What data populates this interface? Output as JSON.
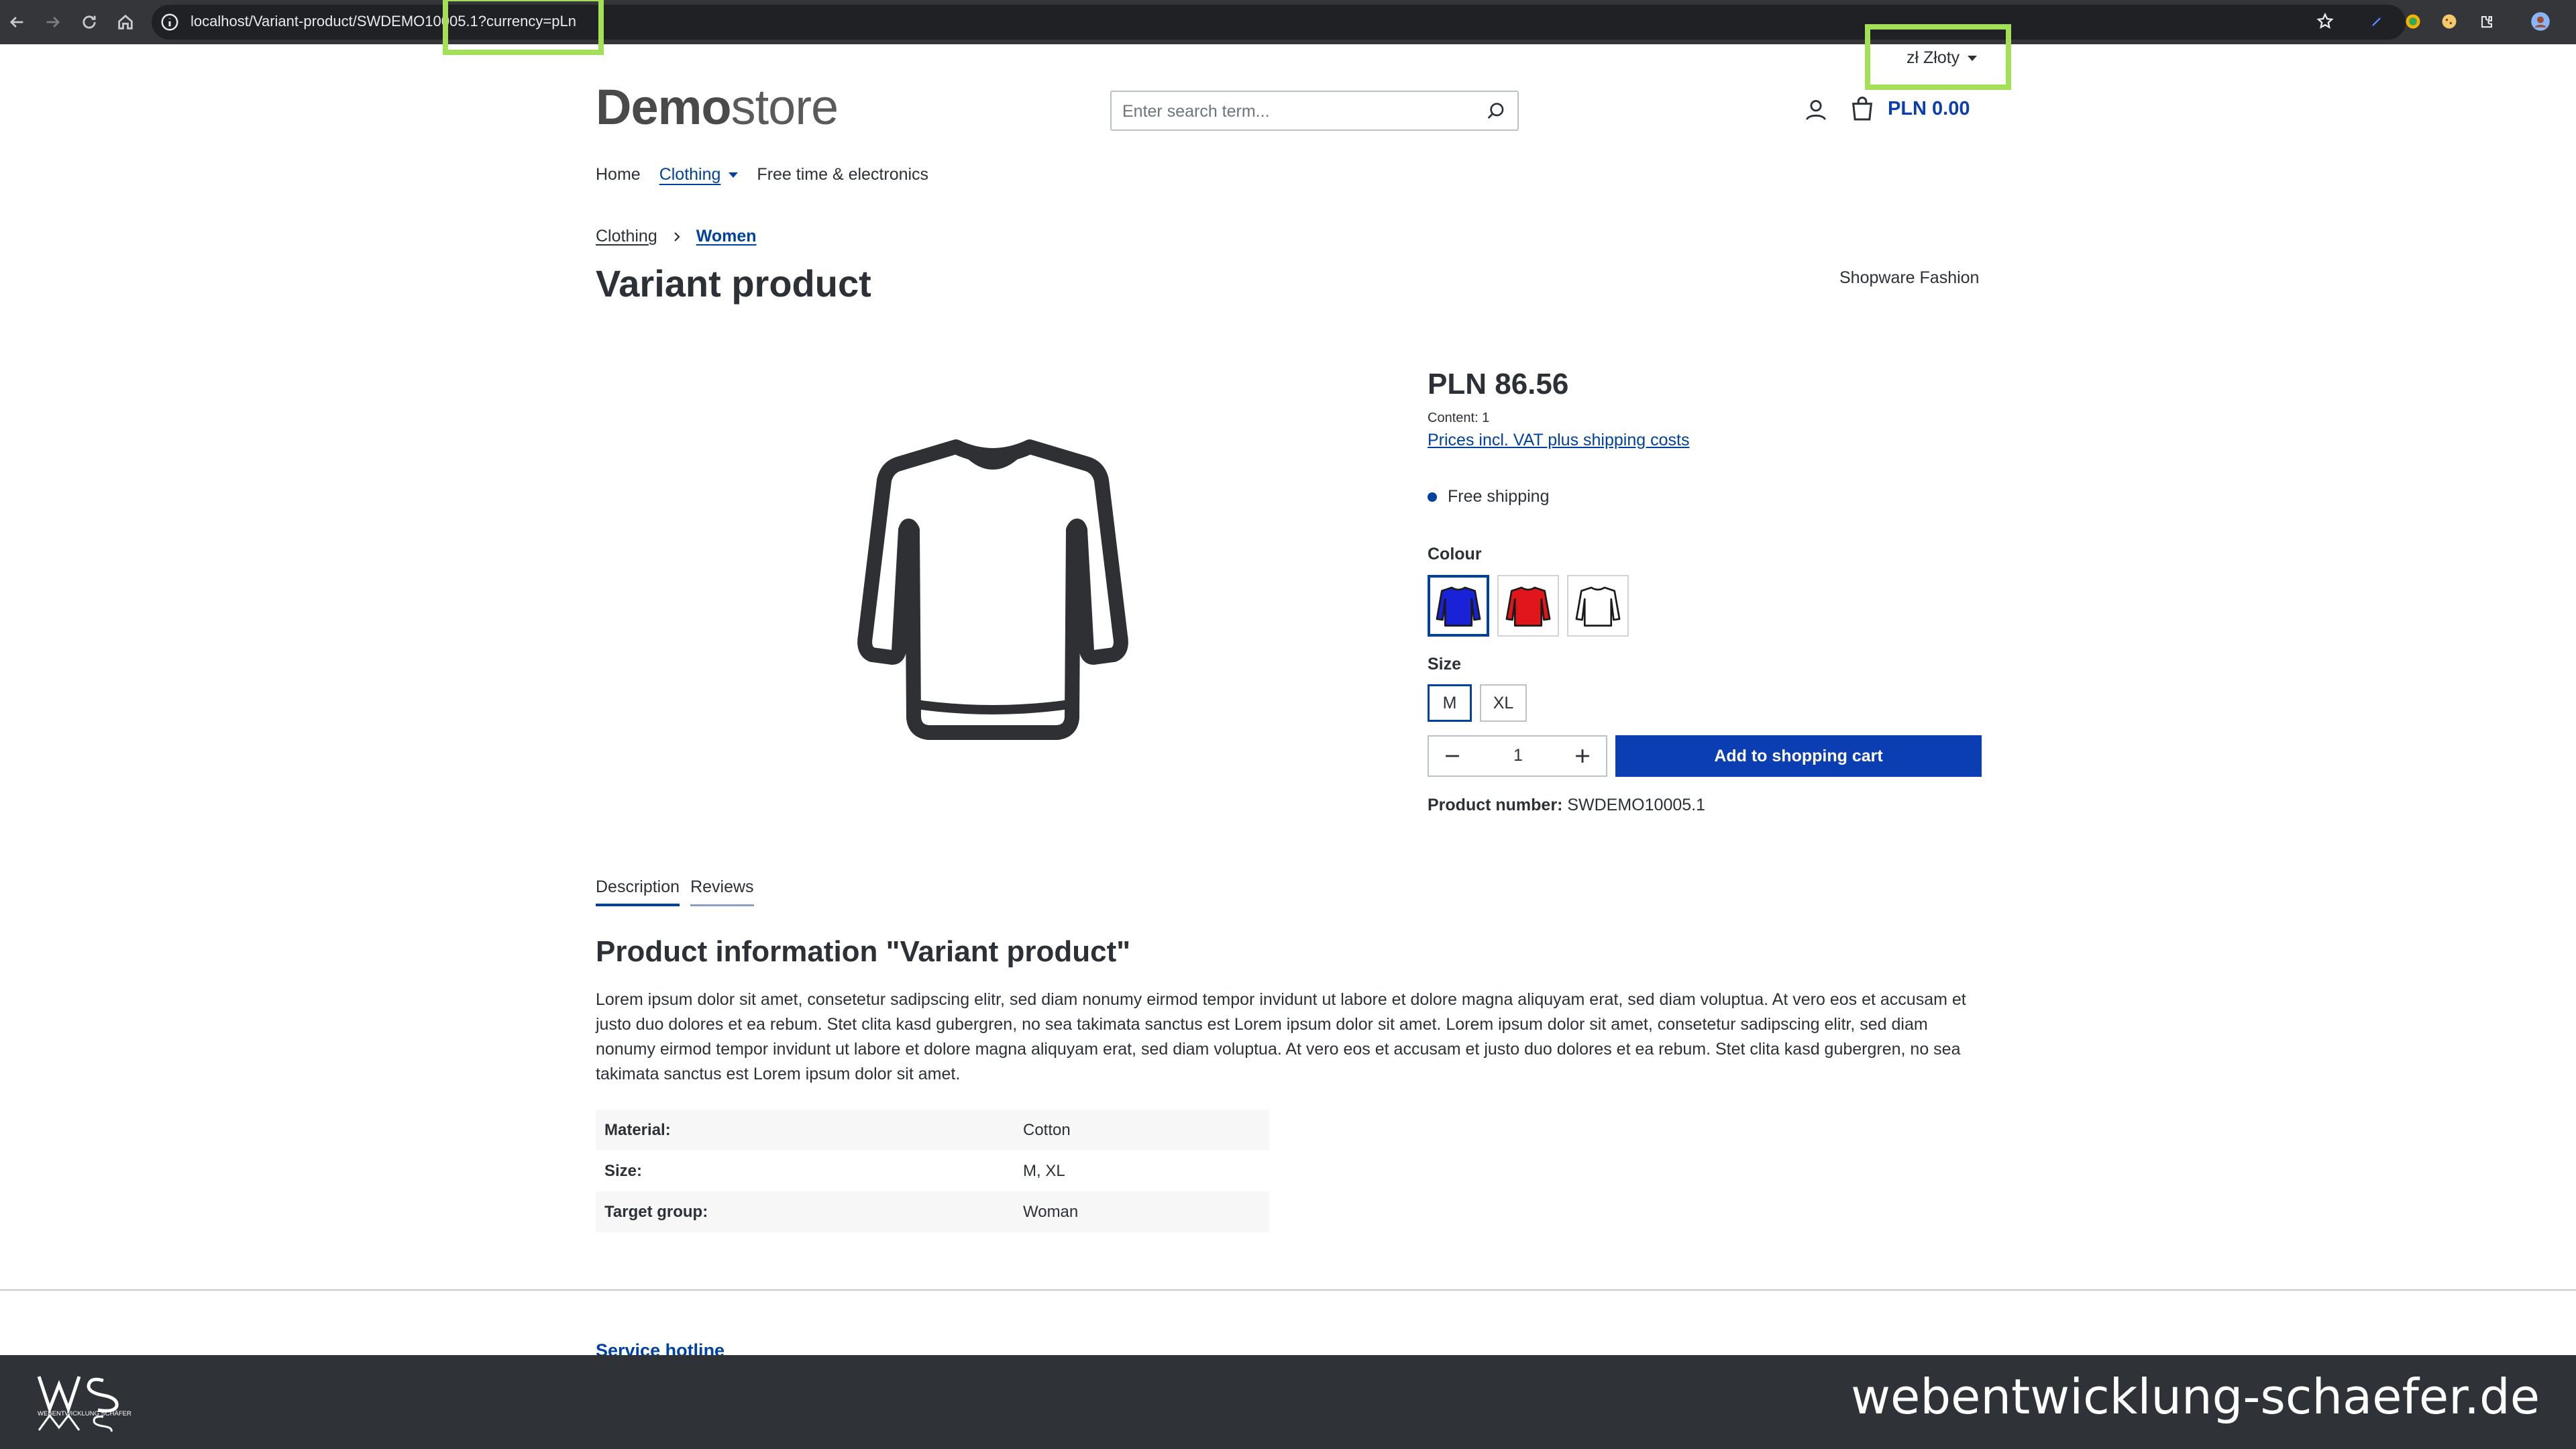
{
  "browser": {
    "url": "localhost/Variant-product/SWDEMO10005.1?currency=pLn",
    "icons": [
      "back-icon",
      "forward-icon",
      "reload-icon",
      "home-icon",
      "info-icon",
      "star-icon",
      "extension-icons",
      "profile-icon"
    ]
  },
  "header": {
    "currency_label": "zł Złoty",
    "logo_bold": "Demo",
    "logo_light": "store",
    "search_placeholder": "Enter search term...",
    "cart_total": "PLN 0.00"
  },
  "nav": {
    "items": [
      "Home",
      "Clothing",
      "Free time & electronics"
    ]
  },
  "breadcrumb": {
    "items": [
      "Clothing",
      "Women"
    ]
  },
  "product": {
    "title": "Variant product",
    "manufacturer": "Shopware Fashion",
    "price": "PLN 86.56",
    "content": "Content: 1",
    "vat_link": "Prices incl. VAT plus shipping costs",
    "shipping": "Free shipping",
    "colour_label": "Colour",
    "colours": [
      {
        "name": "blue",
        "hex": "#1a22d8",
        "selected": true
      },
      {
        "name": "red",
        "hex": "#e0161b",
        "selected": false
      },
      {
        "name": "white",
        "hex": "#ffffff",
        "selected": false
      }
    ],
    "size_label": "Size",
    "sizes": [
      {
        "label": "M",
        "selected": true
      },
      {
        "label": "XL",
        "selected": false
      }
    ],
    "quantity": "1",
    "add_to_cart": "Add to shopping cart",
    "product_number_label": "Product number:",
    "product_number": "SWDEMO10005.1"
  },
  "tabs": [
    "Description",
    "Reviews"
  ],
  "description": {
    "title": "Product information \"Variant product\"",
    "text": "Lorem ipsum dolor sit amet, consetetur sadipscing elitr, sed diam nonumy eirmod tempor invidunt ut labore et dolore magna aliquyam erat, sed diam voluptua. At vero eos et accusam et justo duo dolores et ea rebum. Stet clita kasd gubergren, no sea takimata sanctus est Lorem ipsum dolor sit amet. Lorem ipsum dolor sit amet, consetetur sadipscing elitr, sed diam nonumy eirmod tempor invidunt ut labore et dolore magna aliquyam erat, sed diam voluptua. At vero eos et accusam et justo duo dolores et ea rebum. Stet clita kasd gubergren, no sea takimata sanctus est Lorem ipsum dolor sit amet.",
    "properties": [
      {
        "key": "Material:",
        "value": "Cotton"
      },
      {
        "key": "Size:",
        "value": "M, XL"
      },
      {
        "key": "Target group:",
        "value": "Woman"
      }
    ]
  },
  "footer": {
    "hotline": "Service hotline"
  },
  "watermark": {
    "logo_text": "WEBENTWICKLUNG SCHÄFER",
    "site": "webentwicklung-schaefer.de"
  },
  "colors": {
    "accent": "#0042a0",
    "button": "#0b3db3",
    "highlight": "#a4e057",
    "watermark_bar": "#2f3338"
  }
}
